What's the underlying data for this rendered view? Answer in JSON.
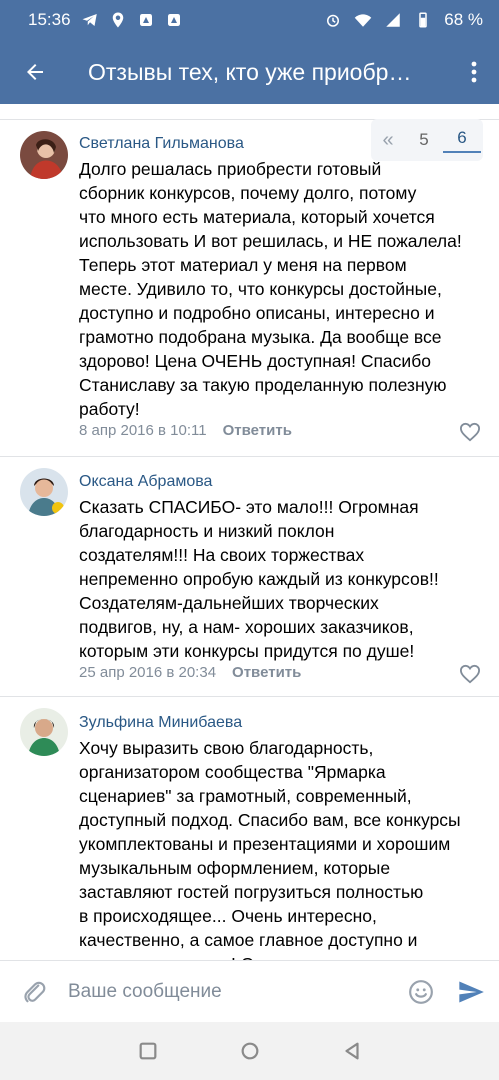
{
  "status_bar": {
    "time": "15:36",
    "battery": "68 %",
    "left_icons": [
      "telegram-icon",
      "location-icon",
      "app-icon-1",
      "app-icon-2"
    ],
    "right_icons": [
      "alarm-icon",
      "wifi-icon",
      "signal-icon",
      "battery-icon"
    ]
  },
  "app_bar": {
    "title": "Отзывы тех, кто уже приобрели",
    "back_icon": "back-arrow-icon",
    "menu_icon": "more-vert-icon"
  },
  "pager": {
    "first": "«",
    "pages": [
      "5",
      "6"
    ],
    "current": "6"
  },
  "comments": [
    {
      "author": "Светлана Гильманова",
      "text_lines": [
        "Долго решалась приобрести готовый",
        "сборник конкурсов, почему долго, потому",
        "что много есть материала, который хочется",
        "использовать И вот решилась, и НЕ пожалела!",
        "Теперь этот материал у меня на первом",
        "месте. Удивило то, что конкурсы достойные,",
        "доступно и подробно описаны, интересно и",
        "грамотно подобрана музыка. Да вообще все",
        "здорово! Цена ОЧЕНЬ доступная! Спасибо",
        "Станиславу за такую проделанную полезную",
        "работу!"
      ],
      "date": "8 апр 2016 в 10:11",
      "reply": "Ответить"
    },
    {
      "author": "Оксана Абрамова",
      "text_lines": [
        "Сказать СПАСИБО- это мало!!! Огромная",
        "благодарность и низкий поклон",
        "создателям!!! На своих торжествах",
        "непременно опробую каждый из конкурсов!!",
        "Создателям-дальнейших творческих",
        "подвигов, ну, а нам- хороших заказчиков,",
        "которым эти конкурсы придутся по душе!"
      ],
      "date": "25 апр 2016 в 20:34",
      "reply": "Ответить"
    },
    {
      "author": "Зульфина Минибаева",
      "text_lines": [
        "Хочу выразить свою благодарность,",
        "организатором сообщества \"Ярмарка",
        "сценариев\" за грамотный, современный,",
        "доступный подход. Спасибо вам, все конкурсы",
        "укомплектованы и презентациями и хорошим",
        "музыкальным оформлением, которые",
        "заставляют гостей погрузиться полностью",
        "в происходящее... Очень интересно,",
        "качественно, а самое главное доступно и",
        "экономия времени! Организатором я желаю"
      ],
      "date": "",
      "reply": ""
    }
  ],
  "input_bar": {
    "placeholder": "Ваше сообщение",
    "attach_icon": "paperclip-icon",
    "emoji_icon": "emoji-icon",
    "send_icon": "send-icon"
  },
  "colors": {
    "header": "#4b71a3",
    "link": "#2a5885",
    "meta": "#818c99",
    "send": "#5181b8"
  }
}
